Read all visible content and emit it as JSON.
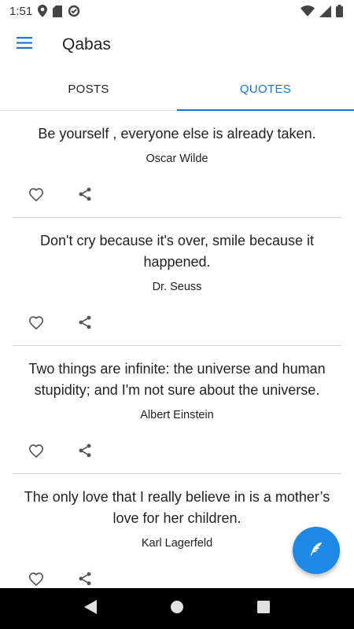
{
  "status_bar": {
    "time": "1:51",
    "icons": [
      "location-icon",
      "sd-card-icon",
      "data-saver-icon",
      "wifi-icon",
      "signal-icon",
      "battery-icon"
    ]
  },
  "app_bar": {
    "title": "Qabas",
    "menu_icon": "hamburger-menu-icon"
  },
  "tabs": [
    {
      "label": "POSTS",
      "active": false
    },
    {
      "label": "QUOTES",
      "active": true
    }
  ],
  "quotes": [
    {
      "text": "Be yourself , everyone else is already taken.",
      "author": "Oscar Wilde"
    },
    {
      "text": "Don't cry because it's over, smile because it happened.",
      "author": "Dr. Seuss"
    },
    {
      "text": "Two things are infinite: the universe and human stupidity; and I'm not sure about the universe.",
      "author": "Albert Einstein"
    },
    {
      "text": "The only love that I really believe in is a mother’s love for her children.",
      "author": "Karl Lagerfeld"
    }
  ],
  "actions": {
    "like_icon": "heart-outline-icon",
    "share_icon": "share-icon"
  },
  "fab": {
    "icon": "quill-icon"
  },
  "nav_bar": {
    "buttons": [
      "back-icon",
      "home-icon",
      "recents-icon"
    ]
  },
  "colors": {
    "accent": "#1976d2",
    "fab": "#1e88e5",
    "nav_bar": "#000000",
    "divider": "#d6d6d6"
  }
}
